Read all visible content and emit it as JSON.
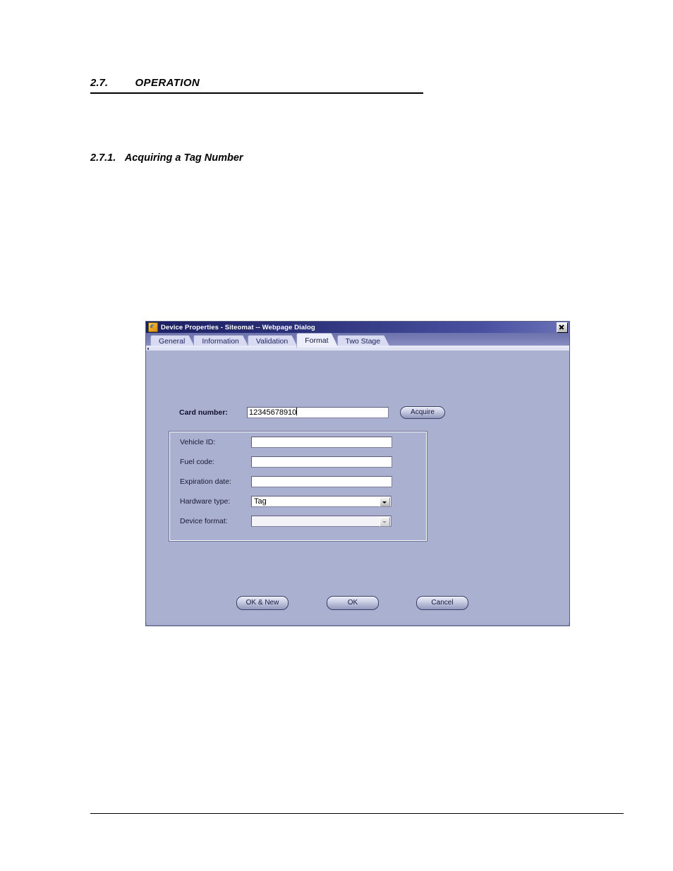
{
  "document": {
    "section": {
      "number": "2.7.",
      "title": "OPERATION"
    },
    "subsection": {
      "number": "2.7.1.",
      "title": "Acquiring a Tag Number"
    }
  },
  "dialog": {
    "title": "Device Properties - Siteomat -- Webpage Dialog",
    "icon": "ie-page-icon",
    "close_icon": "close-icon",
    "tabs": [
      {
        "label": "General",
        "active": false
      },
      {
        "label": "Information",
        "active": false
      },
      {
        "label": "Validation",
        "active": false
      },
      {
        "label": "Format",
        "active": true
      },
      {
        "label": "Two Stage",
        "active": false
      }
    ],
    "card_number": {
      "label": "Card number:",
      "value": "12345678910",
      "placeholder": ""
    },
    "acquire_button": "Acquire",
    "fields": [
      {
        "label": "Vehicle ID:",
        "value": "",
        "type": "text",
        "disabled": false
      },
      {
        "label": "Fuel code:",
        "value": "",
        "type": "text",
        "disabled": false
      },
      {
        "label": "Expiration date:",
        "value": "",
        "type": "text",
        "disabled": false
      },
      {
        "label": "Hardware type:",
        "value": "Tag",
        "type": "select",
        "disabled": false
      },
      {
        "label": "Device format:",
        "value": "",
        "type": "select",
        "disabled": true
      }
    ],
    "buttons": {
      "ok_new": "OK & New",
      "ok": "OK",
      "cancel": "Cancel"
    },
    "colors": {
      "body": "#aab0d0",
      "titlebar_start": "#1b1f63",
      "titlebar_end": "#6b72b8",
      "tab_active": "#eceefb",
      "tab_inactive": "#d7daf0"
    }
  }
}
